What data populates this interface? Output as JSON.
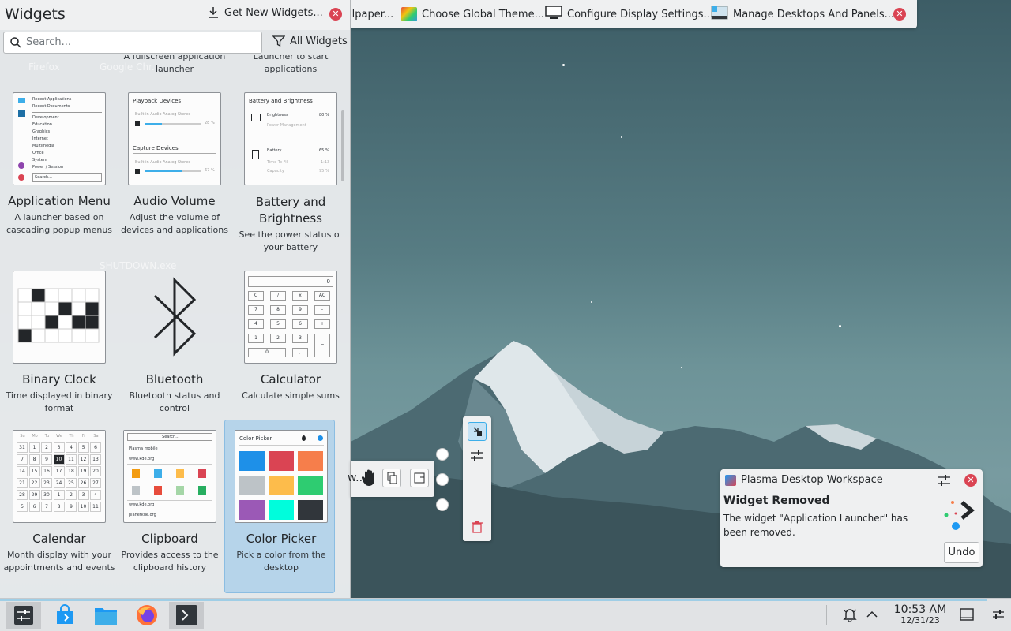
{
  "topbar": {
    "items": [
      {
        "label": "llpaper...",
        "icon": "wallpaper-icon"
      },
      {
        "label": "Choose Global Theme...",
        "icon": "theme-icon"
      },
      {
        "label": "Configure Display Settings...",
        "icon": "display-icon"
      },
      {
        "label": "Manage Desktops And Panels...",
        "icon": "panels-icon"
      }
    ]
  },
  "widgets_panel": {
    "title": "Widgets",
    "get_new_label": "Get New Widgets...",
    "search_placeholder": "Search...",
    "filter_label": "All Widgets",
    "partial_top": [
      "A fullscreen application launcher",
      "Launcher to start applications"
    ],
    "ghost_labels": [
      "Firefox",
      "Google Chr...",
      "SHUTDOWN.exe"
    ],
    "tiles": [
      {
        "name": "Application Menu",
        "desc": "A launcher based on cascading popup menus"
      },
      {
        "name": "Audio Volume",
        "desc": "Adjust the volume of devices and applications"
      },
      {
        "name": "Battery and Brightness",
        "desc": "See the power status of your battery"
      },
      {
        "name": "Binary Clock",
        "desc": "Time displayed in binary format"
      },
      {
        "name": "Bluetooth",
        "desc": "Bluetooth status and control"
      },
      {
        "name": "Calculator",
        "desc": "Calculate simple sums"
      },
      {
        "name": "Calendar",
        "desc": "Month display with your appointments and events"
      },
      {
        "name": "Clipboard",
        "desc": "Provides access to the clipboard history"
      },
      {
        "name": "Color Picker",
        "desc": "Pick a color from the desktop"
      }
    ],
    "thumb_text": {
      "app_menu": [
        "Recent Applications",
        "Recent Documents",
        "Development",
        "Education",
        "Graphics",
        "Internet",
        "Multimedia",
        "Office",
        "System",
        "Power / Session",
        "Search..."
      ],
      "audio": [
        "Playback Devices",
        "Built-in Audio Analog Stereo",
        "28 %",
        "Capture Devices",
        "Built-in Audio Analog Stereo",
        "67 %"
      ],
      "battery": [
        "Battery and Brightness",
        "Brightness",
        "80 %",
        "Power Management",
        "Battery",
        "65 %",
        "Time To Fill",
        "1:13",
        "Capacity",
        "95 %"
      ],
      "calculator": [
        "0",
        "C",
        "/",
        "x",
        "AC",
        "7",
        "8",
        "9",
        "-",
        "4",
        "5",
        "6",
        "+",
        "1",
        "2",
        "3",
        "=",
        "0",
        ","
      ],
      "calendar_head": [
        "Su",
        "Mo",
        "Tu",
        "We",
        "Th",
        "Fr",
        "Sa"
      ],
      "calendar_days": [
        "31",
        "1",
        "2",
        "3",
        "4",
        "5",
        "6",
        "7",
        "8",
        "9",
        "10",
        "11",
        "12",
        "13",
        "14",
        "15",
        "16",
        "17",
        "18",
        "19",
        "20",
        "21",
        "22",
        "23",
        "24",
        "25",
        "26",
        "27",
        "28",
        "29",
        "30",
        "1",
        "2",
        "3",
        "4",
        "5",
        "6",
        "7",
        "8",
        "9",
        "10",
        "11"
      ],
      "clipboard": [
        "Search...",
        "Plasma mobile",
        "www.kde.org",
        "www.kde.org",
        "planetkde.org"
      ],
      "color_picker": "Color Picker"
    },
    "color_swatches": [
      "#1e90e8",
      "#da4453",
      "#f67e4b",
      "#bdc3c7",
      "#fdbc4b",
      "#2ecc71",
      "#9b59b6",
      "#00fddc",
      "#31363b"
    ]
  },
  "widget_toolbar": {
    "partial_text": "w..."
  },
  "notification": {
    "app": "Plasma Desktop Workspace",
    "title": "Widget Removed",
    "body": "The widget \"Application Launcher\" has been removed.",
    "undo_label": "Undo"
  },
  "taskbar": {
    "time": "10:53 AM",
    "date": "12/31/23"
  }
}
